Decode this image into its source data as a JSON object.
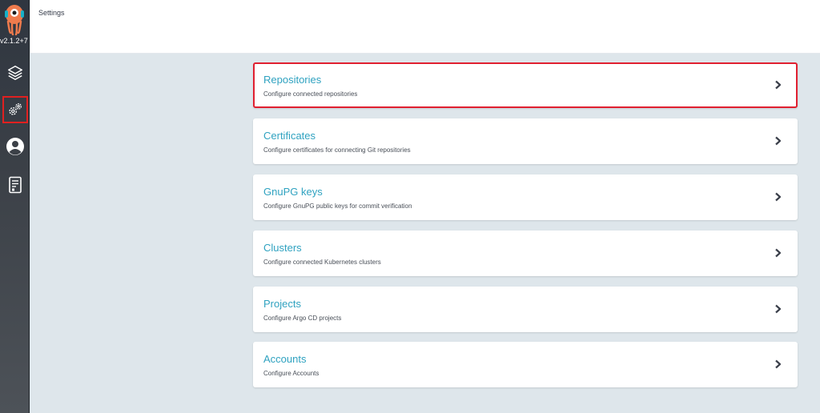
{
  "app": {
    "version": "v2.1.2+7",
    "page_title": "Settings"
  },
  "sidebar": {
    "items": [
      {
        "name": "applications",
        "icon": "layers-icon"
      },
      {
        "name": "settings",
        "icon": "gear-icon",
        "active": true
      },
      {
        "name": "user-info",
        "icon": "user-icon"
      },
      {
        "name": "documentation",
        "icon": "book-icon"
      }
    ]
  },
  "settings": {
    "cards": [
      {
        "title": "Repositories",
        "description": "Configure connected repositories"
      },
      {
        "title": "Certificates",
        "description": "Configure certificates for connecting Git repositories"
      },
      {
        "title": "GnuPG keys",
        "description": "Configure GnuPG public keys for commit verification"
      },
      {
        "title": "Clusters",
        "description": "Configure connected Kubernetes clusters"
      },
      {
        "title": "Projects",
        "description": "Configure Argo CD projects"
      },
      {
        "title": "Accounts",
        "description": "Configure Accounts"
      }
    ]
  },
  "colors": {
    "accent": "#2fa2c0",
    "highlight": "#e02030",
    "background": "#dee6eb"
  }
}
